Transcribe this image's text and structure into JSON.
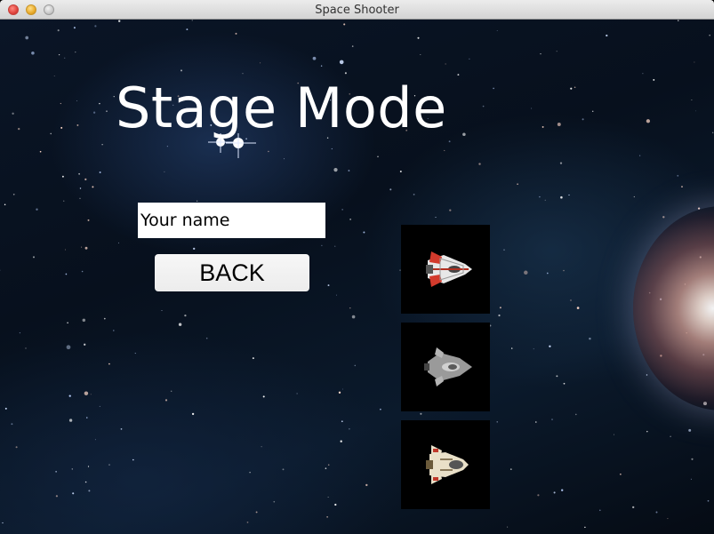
{
  "window": {
    "title": "Space Shooter"
  },
  "menu": {
    "heading": "Stage Mode",
    "name_input": {
      "value": "",
      "placeholder": "Your name"
    },
    "back_label": "BACK"
  },
  "ships": [
    {
      "name": "red-white fighter",
      "icon": "ship-red-icon"
    },
    {
      "name": "grey fighter",
      "icon": "ship-grey-icon"
    },
    {
      "name": "cream-red fighter",
      "icon": "ship-cream-icon"
    }
  ],
  "colors": {
    "background": "#07101d",
    "heading_text": "#ffffff",
    "button_bg": "#f2f2f2"
  }
}
